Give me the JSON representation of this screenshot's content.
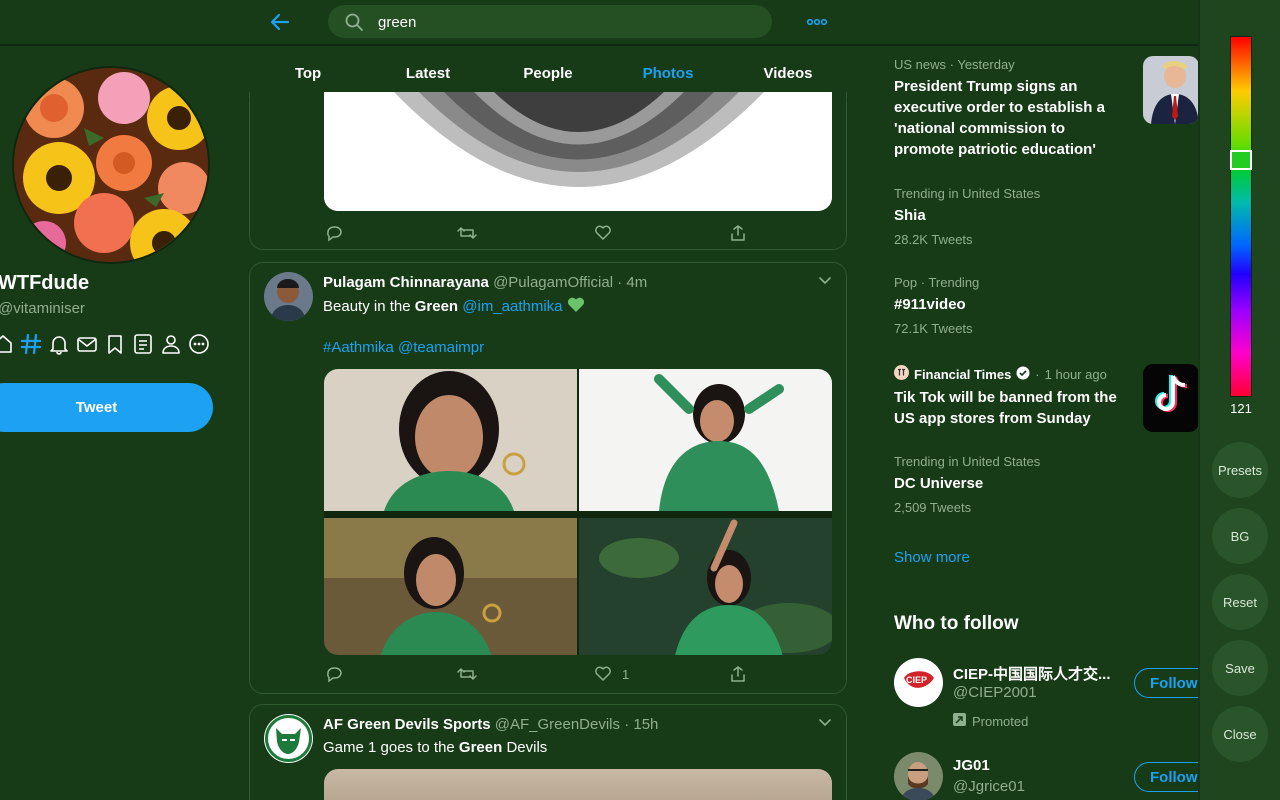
{
  "colors": {
    "accent": "#1da1f2",
    "bg": "#173a17",
    "muted": "#8fb08f"
  },
  "search": {
    "value": "green"
  },
  "tabs": [
    {
      "label": "Top"
    },
    {
      "label": "Latest"
    },
    {
      "label": "People"
    },
    {
      "label": "Photos",
      "active": true
    },
    {
      "label": "Videos"
    }
  ],
  "profile": {
    "name": "WTFdude",
    "handle": "@vitaminiser",
    "tweet_label": "Tweet"
  },
  "nav_icons": [
    "home-icon",
    "explore-hash-icon",
    "notifications-bell-icon",
    "messages-envelope-icon",
    "bookmarks-icon",
    "lists-icon",
    "profile-icon",
    "more-circle-icon"
  ],
  "tweets": [
    {
      "likes": ""
    },
    {
      "name": "Pulagam Chinnarayana",
      "handle": "@PulagamOfficial",
      "time": "4m",
      "text_pre": "Beauty in the ",
      "text_bold": "Green",
      "mention": "@im_aathmika",
      "hashtags": "#Aathmika @teamaimpr",
      "likes": "1"
    },
    {
      "name": "AF Green Devils Sports",
      "handle": "@AF_GreenDevils",
      "time": "15h",
      "text_pre": "Game 1 goes to the ",
      "text_bold": "Green",
      "text_post": " Devils"
    }
  ],
  "trends": [
    {
      "meta": "US news · Yesterday",
      "title": "President Trump signs an executive order to establish a 'national commission to promote patriotic education'"
    },
    {
      "meta": "Trending in United States",
      "title": "Shia",
      "count": "28.2K Tweets"
    },
    {
      "meta": "Pop · Trending",
      "title": "#911video",
      "count": "72.1K Tweets"
    },
    {
      "source": "Financial Times",
      "meta": "1 hour ago",
      "title": "Tik Tok will be banned from the US app stores from Sunday"
    },
    {
      "meta": "Trending in United States",
      "title": "DC Universe",
      "count": "2,509 Tweets"
    }
  ],
  "show_more": "Show more",
  "who_to_follow": {
    "title": "Who to follow",
    "accounts": [
      {
        "name": "CIEP-中国国际人才交...",
        "handle": "@CIEP2001",
        "promoted": "Promoted",
        "follow": "Follow"
      },
      {
        "name": "JG01",
        "handle": "@Jgrice01",
        "follow": "Follow"
      }
    ]
  },
  "color_panel": {
    "hue": "121",
    "buttons": [
      "Presets",
      "BG",
      "Reset",
      "Save",
      "Close"
    ]
  }
}
